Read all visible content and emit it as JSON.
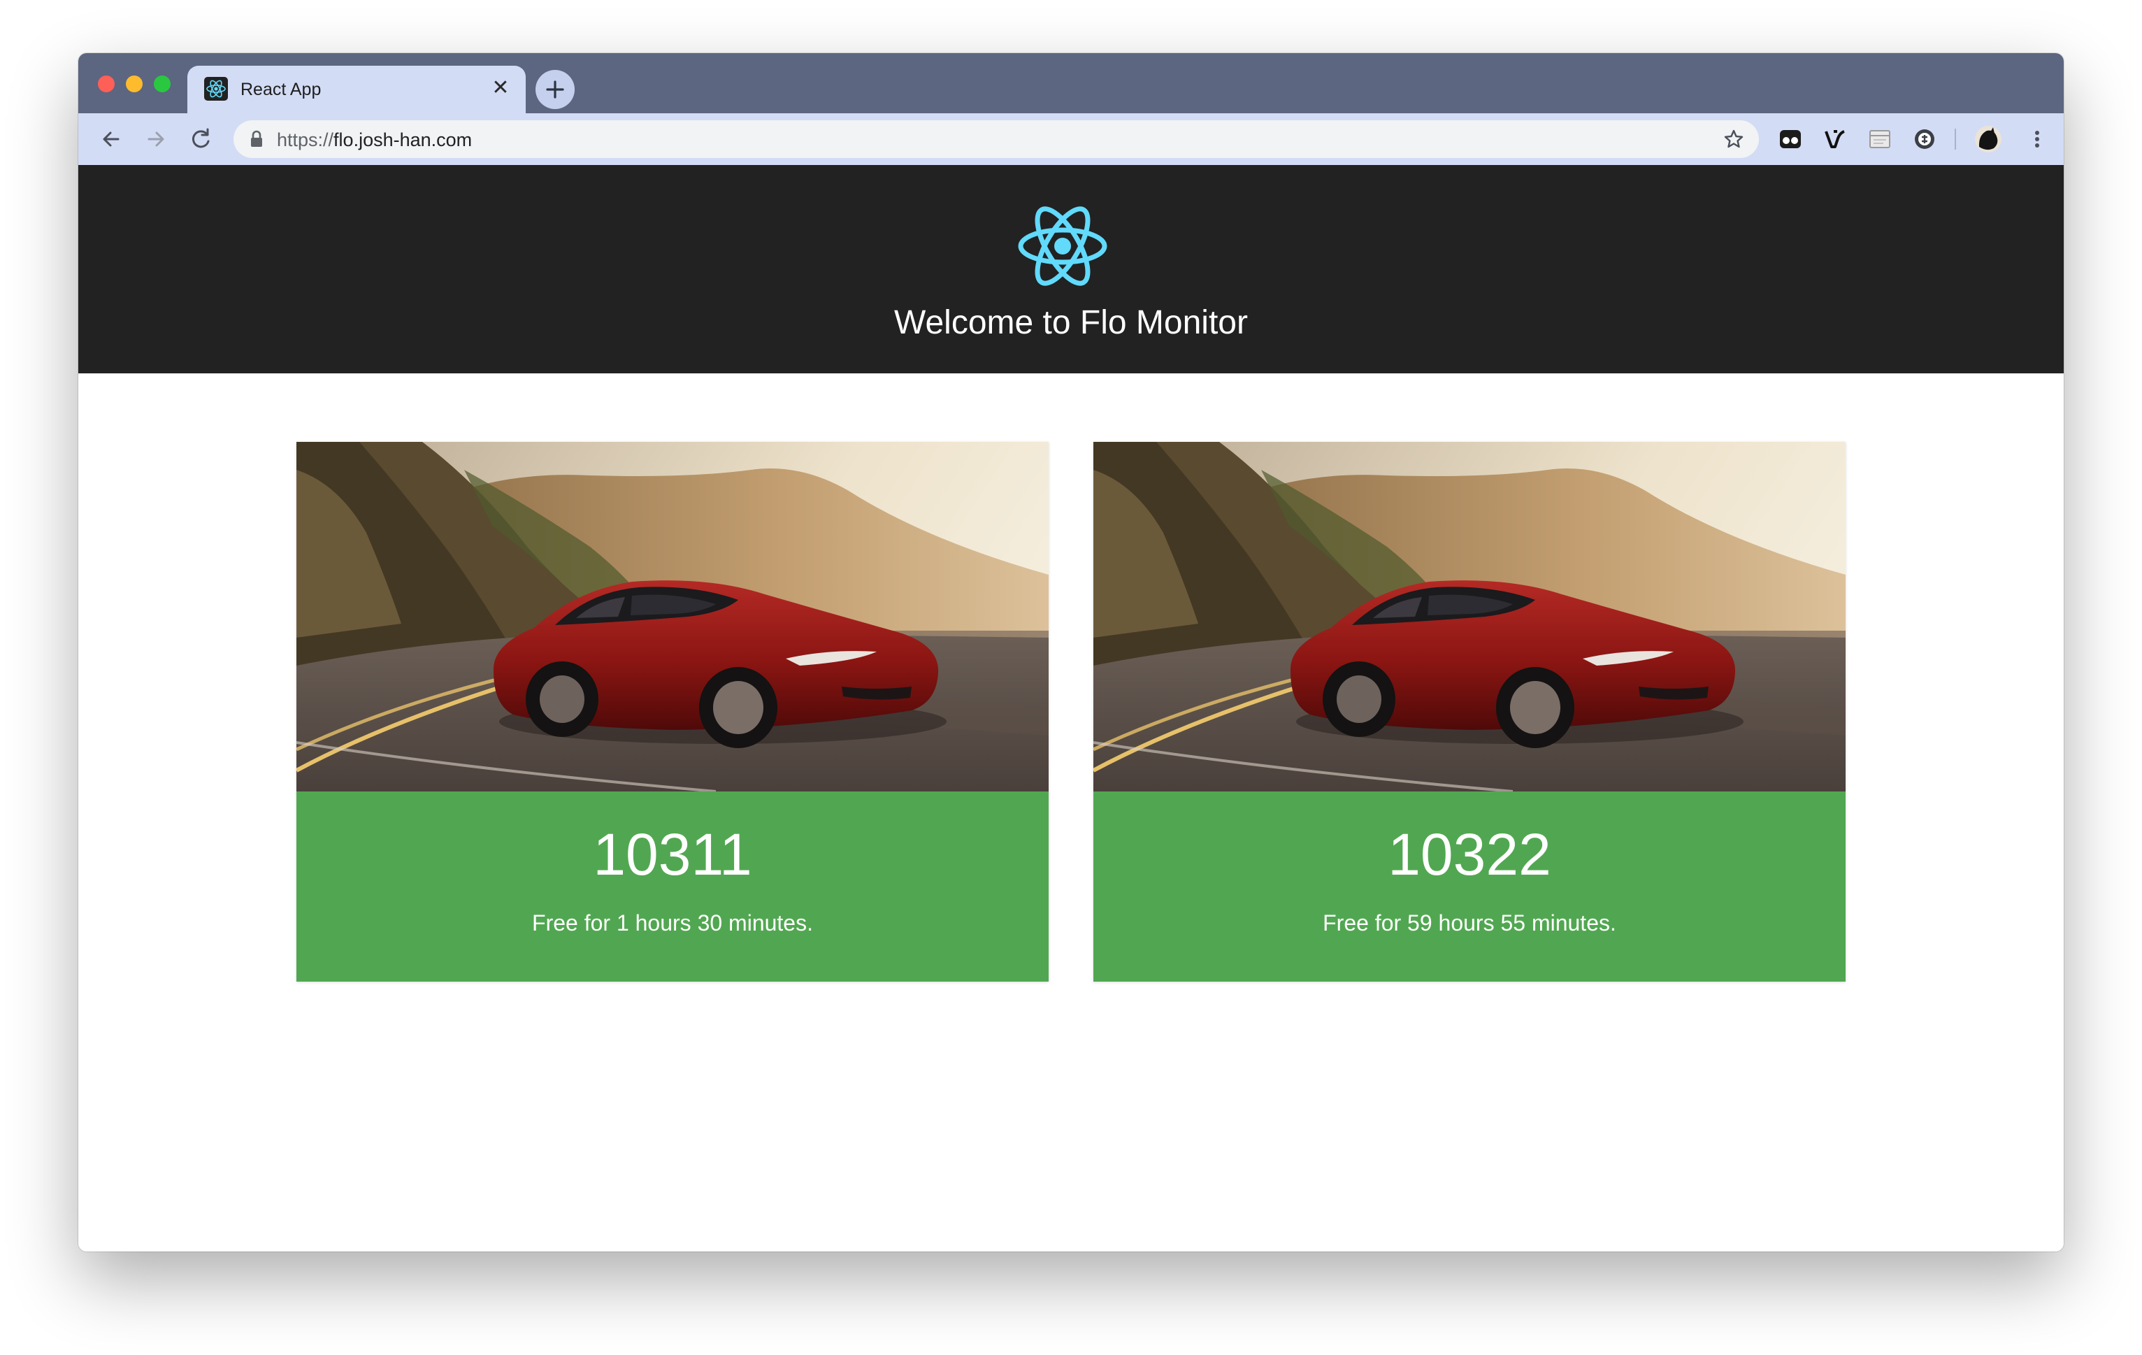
{
  "browser": {
    "tab": {
      "title": "React App",
      "favicon": "react-icon",
      "close_glyph": "✕"
    },
    "new_tab_icon": "plus-icon",
    "url_scheme": "https://",
    "url_host": "flo.josh-han.com",
    "extensions": [
      "extension-icon-1",
      "extension-icon-2",
      "extension-icon-3",
      "extension-icon-4"
    ],
    "profile_icon": "profile-avatar-icon",
    "menu_icon": "kebab-menu-icon"
  },
  "header": {
    "logo": "react-atom-logo",
    "title": "Welcome to Flo Monitor",
    "background": "#222222",
    "logo_color": "#61dafb"
  },
  "cards": [
    {
      "image": "red-sports-car-on-coastal-road",
      "number": "10311",
      "status": "Free for 1 hours 30 minutes.",
      "status_color": "#51a751"
    },
    {
      "image": "red-sports-car-on-coastal-road",
      "number": "10322",
      "status": "Free for 59 hours 55 minutes.",
      "status_color": "#51a751"
    }
  ]
}
